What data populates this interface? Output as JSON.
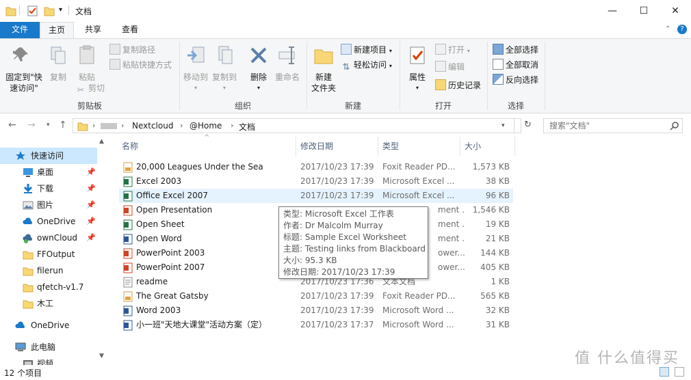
{
  "window": {
    "title": "文档",
    "minimize": "—",
    "maximize": "☐",
    "close": "✕"
  },
  "tabs": {
    "file": "文件",
    "home": "主页",
    "share": "共享",
    "view": "查看"
  },
  "ribbon": {
    "clipboard": {
      "pin_quick_access": "固定到\"快速访问\"",
      "copy": "复制",
      "paste": "粘贴",
      "copy_path": "复制路径",
      "paste_shortcut": "粘贴快捷方式",
      "cut": "剪切",
      "label": "剪贴板"
    },
    "organize": {
      "move_to": "移动到",
      "copy_to": "复制到",
      "delete": "删除",
      "rename": "重命名",
      "label": "组织"
    },
    "new": {
      "new_folder": "新建\n文件夹",
      "new_item": "新建项目",
      "easy_access": "轻松访问",
      "label": "新建"
    },
    "open": {
      "properties": "属性",
      "open": "打开",
      "edit": "编辑",
      "history": "历史记录",
      "label": "打开"
    },
    "select": {
      "select_all": "全部选择",
      "select_none": "全部取消",
      "invert": "反向选择",
      "label": "选择"
    }
  },
  "address": {
    "crumbs": [
      "Nextcloud",
      "@Home",
      "文档"
    ],
    "search_placeholder": "搜索\"文档\""
  },
  "nav": {
    "items": [
      {
        "label": "快速访问",
        "pinned": false,
        "icon": "star-icon"
      },
      {
        "label": "桌面",
        "pinned": true,
        "icon": "desktop-icon"
      },
      {
        "label": "下载",
        "pinned": true,
        "icon": "download-icon"
      },
      {
        "label": "图片",
        "pinned": true,
        "icon": "pictures-icon"
      },
      {
        "label": "OneDrive",
        "pinned": true,
        "icon": "onedrive-icon"
      },
      {
        "label": "ownCloud",
        "pinned": true,
        "icon": "owncloud-icon"
      },
      {
        "label": "FFOutput",
        "pinned": false,
        "icon": "folder-icon"
      },
      {
        "label": "filerun",
        "pinned": false,
        "icon": "folder-icon"
      },
      {
        "label": "qfetch-v1.7",
        "pinned": false,
        "icon": "folder-icon"
      },
      {
        "label": "木工",
        "pinned": false,
        "icon": "folder-icon"
      },
      {
        "label": "OneDrive",
        "pinned": false,
        "icon": "onedrive-icon"
      },
      {
        "label": "此电脑",
        "pinned": false,
        "icon": "computer-icon"
      },
      {
        "label": "视频",
        "pinned": false,
        "icon": "video-icon"
      }
    ]
  },
  "list": {
    "headers": {
      "name": "名称",
      "date": "修改日期",
      "type": "类型",
      "size": "大小"
    },
    "rows": [
      {
        "name": "20,000 Leagues Under the Sea",
        "date": "2017/10/23 17:39",
        "type": "Foxit Reader PD...",
        "size": "1,573 KB",
        "kind": "pdf"
      },
      {
        "name": "Excel 2003",
        "date": "2017/10/23 17:39",
        "type": "Microsoft Excel ...",
        "size": "38 KB",
        "kind": "excel"
      },
      {
        "name": "Office Excel 2007",
        "date": "2017/10/23 17:39",
        "type": "Microsoft Excel ...",
        "size": "96 KB",
        "kind": "excel"
      },
      {
        "name": "Open Presentation",
        "date": "",
        "type": "ment ...",
        "size": "1,546 KB",
        "kind": "odp"
      },
      {
        "name": "Open Sheet",
        "date": "",
        "type": "ment ...",
        "size": "19 KB",
        "kind": "ods"
      },
      {
        "name": "Open Word",
        "date": "",
        "type": "ment ...",
        "size": "21 KB",
        "kind": "odt"
      },
      {
        "name": "PowerPoint 2003",
        "date": "",
        "type": "ower...",
        "size": "144 KB",
        "kind": "ppt"
      },
      {
        "name": "PowerPoint 2007",
        "date": "",
        "type": "ower...",
        "size": "405 KB",
        "kind": "ppt"
      },
      {
        "name": "readme",
        "date": "2017/10/23 17:36",
        "type": "文本文档",
        "size": "1 KB",
        "kind": "txt"
      },
      {
        "name": "The Great Gatsby",
        "date": "2017/10/23 17:39",
        "type": "Foxit Reader PD...",
        "size": "565 KB",
        "kind": "pdf"
      },
      {
        "name": "Word 2003",
        "date": "2017/10/23 17:39",
        "type": "Microsoft Word ...",
        "size": "32 KB",
        "kind": "word"
      },
      {
        "name": "小一班\"天地大课堂\"活动方案（定）",
        "date": "2017/10/23 17:37",
        "type": "Microsoft Word ...",
        "size": "31 KB",
        "kind": "word"
      }
    ]
  },
  "tooltip": {
    "type": "类型: Microsoft Excel 工作表",
    "author": "作者: Dr Malcolm Murray",
    "title": "标题: Sample Excel Worksheet",
    "subject": "主题: Testing links from Blackboard",
    "size": "大小: 95.3 KB",
    "modified": "修改日期: 2017/10/23 17:39"
  },
  "status": {
    "count": "12 个项目"
  },
  "watermark": "值 什么值得买",
  "colors": {
    "accent": "#1979ca",
    "selection": "#e5f3ff",
    "folder": "#f8d775"
  }
}
